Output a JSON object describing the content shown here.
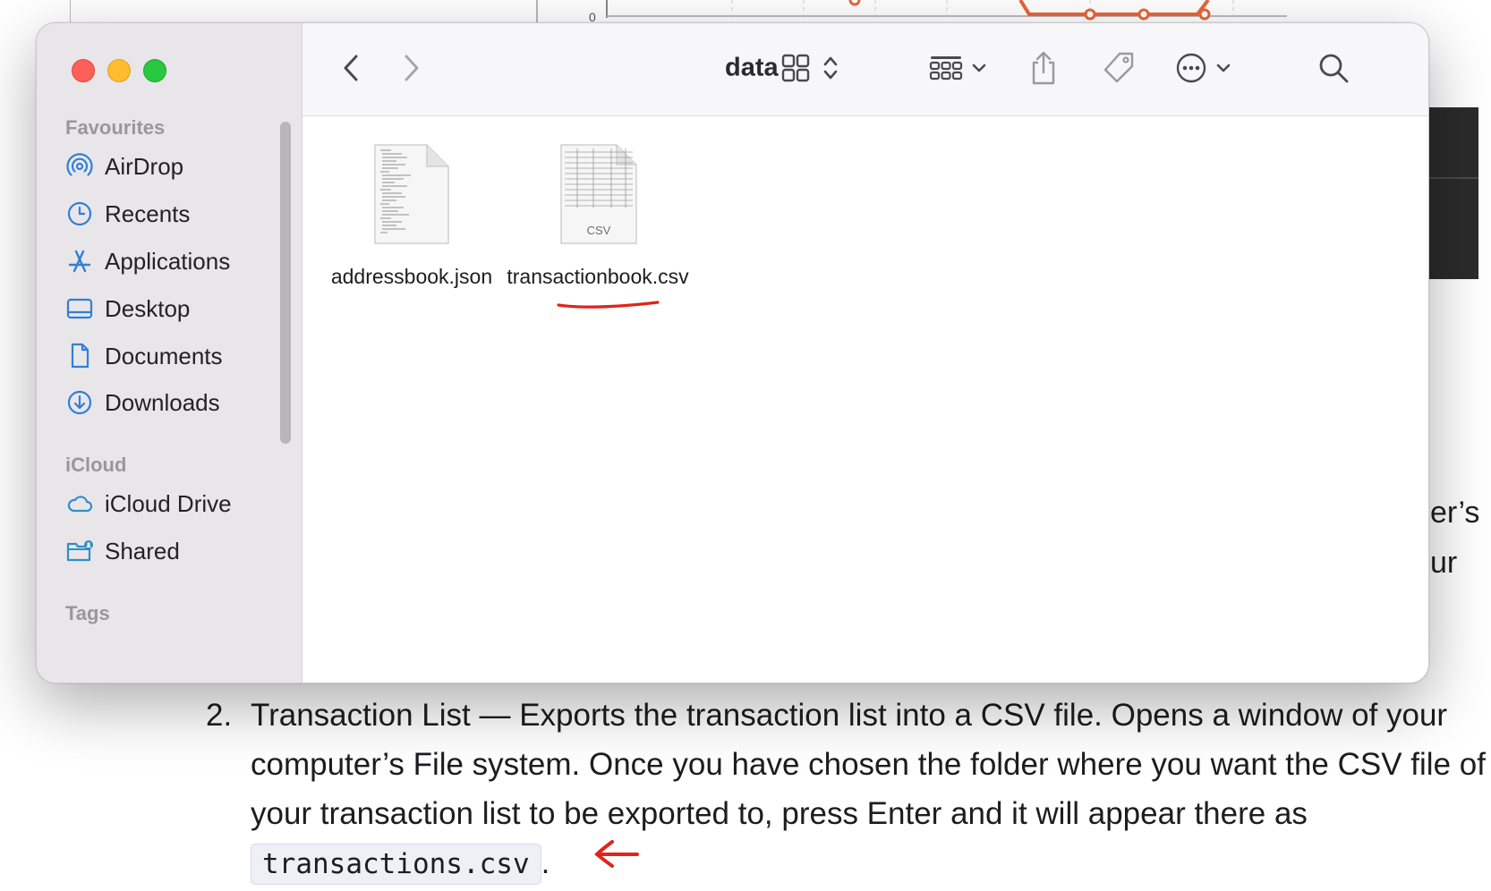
{
  "background": {
    "chart_fragment": {
      "y_tick_label": "0"
    },
    "doc_fragments": [
      "er’s",
      "ur"
    ],
    "list_item": {
      "number": "2.",
      "text": "Transaction List — Exports the transaction list into a CSV file. Opens a window of your computer’s File system. Once you have chosen the folder where you want the CSV file of your transaction list to be exported to, press Enter and it will appear there as",
      "code": "transactions.csv",
      "trailing": "."
    }
  },
  "finder": {
    "title": "data",
    "toolbar": {
      "back": "back-chevron-icon",
      "forward": "forward-chevron-icon",
      "view_mode": "icon-grid-view-icon",
      "group": "group-by-icon",
      "share": "share-icon",
      "tags": "tag-icon",
      "more": "ellipsis-circle-icon",
      "search": "search-icon"
    },
    "sidebar": {
      "sections": [
        {
          "title": "Favourites",
          "items": [
            {
              "label": "AirDrop",
              "icon": "airdrop-icon"
            },
            {
              "label": "Recents",
              "icon": "clock-icon"
            },
            {
              "label": "Applications",
              "icon": "applications-icon"
            },
            {
              "label": "Desktop",
              "icon": "desktop-icon"
            },
            {
              "label": "Documents",
              "icon": "document-icon"
            },
            {
              "label": "Downloads",
              "icon": "download-icon"
            }
          ]
        },
        {
          "title": "iCloud",
          "items": [
            {
              "label": "iCloud Drive",
              "icon": "cloud-icon"
            },
            {
              "label": "Shared",
              "icon": "shared-folder-icon"
            }
          ]
        },
        {
          "title": "Tags",
          "items": []
        }
      ]
    },
    "files": [
      {
        "name": "addressbook.json",
        "badge": ""
      },
      {
        "name": "transactionbook.csv",
        "badge": "CSV"
      }
    ]
  },
  "colors": {
    "traffic_close": "#fe5f57",
    "traffic_minimize": "#febc2e",
    "traffic_maximize": "#28c840",
    "sidebar_icon": "#2f7fd8",
    "annotation_red": "#e2231a"
  }
}
